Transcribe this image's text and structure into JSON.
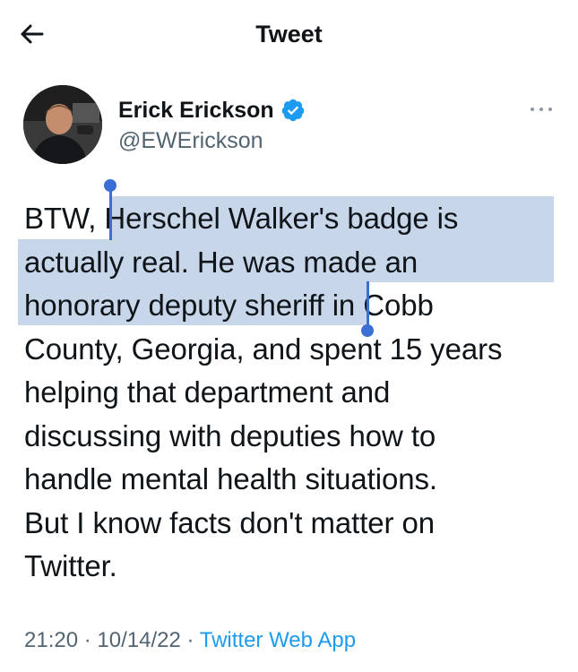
{
  "header": {
    "back_icon": "arrow-left-icon",
    "title": "Tweet"
  },
  "author": {
    "name": "Erick Erickson",
    "handle": "@EWErickson",
    "verified": true,
    "verified_icon": "verified-badge-icon",
    "verified_color": "#1d9bf0"
  },
  "more_icon": "more-dots-icon",
  "tweet": {
    "lines": [
      "BTW, Herschel Walker's badge is",
      "actually real.  He was made an",
      "honorary deputy sheriff in Cobb",
      "County, Georgia, and spent 15 years",
      "helping that department and",
      "discussing with deputies how to",
      "handle mental health situations.",
      "But I know facts don't matter on",
      "Twitter."
    ],
    "selected_text": "Herschel Walker's badge is actually real.  He was made an honorary deputy sheriff",
    "selection_color": "#a1bbdb",
    "caret_color": "#3b6fd6"
  },
  "meta": {
    "time": "21:20",
    "separator": "·",
    "date": "10/14/22",
    "source": "Twitter Web App",
    "link_color": "#1d9bf0"
  }
}
